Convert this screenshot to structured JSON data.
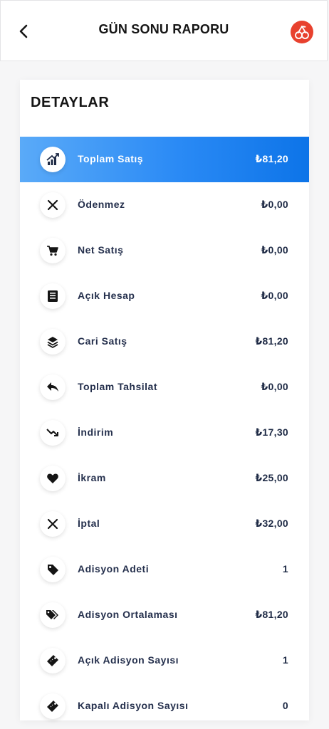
{
  "header": {
    "title": "GÜN SONU RAPORU",
    "back_icon": "chevron-left-icon",
    "brand_icon": "cherry-icon",
    "brand_color": "#e8412e"
  },
  "card": {
    "title": "DETAYLAR",
    "accent_color": "#2a8af5",
    "rows": [
      {
        "label": "Toplam Satış",
        "value": "₺81,20",
        "icon": "chart-up-icon",
        "active": true
      },
      {
        "label": "Ödenmez",
        "value": "₺0,00",
        "icon": "close-icon"
      },
      {
        "label": "Net Satış",
        "value": "₺0,00",
        "icon": "cart-icon"
      },
      {
        "label": "Açık Hesap",
        "value": "₺0,00",
        "icon": "ledger-icon"
      },
      {
        "label": "Cari Satış",
        "value": "₺81,20",
        "icon": "layers-icon"
      },
      {
        "label": "Toplam Tahsilat",
        "value": "₺0,00",
        "icon": "reply-icon"
      },
      {
        "label": "İndirim",
        "value": "₺17,30",
        "icon": "trend-down-icon"
      },
      {
        "label": "İkram",
        "value": "₺25,00",
        "icon": "heart-icon"
      },
      {
        "label": "İptal",
        "value": "₺32,00",
        "icon": "close-icon"
      },
      {
        "label": "Adisyon Adeti",
        "value": "1",
        "icon": "tag-icon"
      },
      {
        "label": "Adisyon Ortalaması",
        "value": "₺81,20",
        "icon": "tags-icon"
      },
      {
        "label": "Açık Adisyon Sayısı",
        "value": "1",
        "icon": "ticket-icon"
      },
      {
        "label": "Kapalı Adisyon Sayısı",
        "value": "0",
        "icon": "ticket-icon"
      }
    ]
  }
}
